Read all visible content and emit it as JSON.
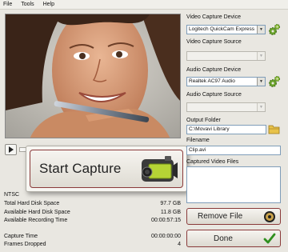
{
  "menu": [
    "File",
    "Tools",
    "Help"
  ],
  "preview": {
    "play_icon": "play-icon"
  },
  "start_capture": {
    "label": "Start Capture",
    "icon": "camcorder-icon"
  },
  "info": {
    "standard": "NTSC",
    "total_disk_label": "Total Hard Disk Space",
    "total_disk_value": "97.7 GB",
    "available_disk_label": "Available Hard Disk Space",
    "available_disk_value": "11.8 GB",
    "available_time_label": "Available Recording Time",
    "available_time_value": "00:00:57:15",
    "capture_time_label": "Capture Time",
    "capture_time_value": "00:00:00:00",
    "frames_dropped_label": "Frames Dropped",
    "frames_dropped_value": "4"
  },
  "right": {
    "video_device_label": "Video Capture Device",
    "video_device_value": "Logitech QuickCam Express",
    "video_source_label": "Video Capture Source",
    "video_source_value": "",
    "audio_device_label": "Audio Capture Device",
    "audio_device_value": "Realtek AC97 Audio",
    "audio_source_label": "Audio Capture Source",
    "audio_source_value": "",
    "output_folder_label": "Output Folder",
    "output_folder_value": "C:\\Movavi Library",
    "filename_label": "Filename",
    "filename_value": "Clip.avi",
    "captured_files_label": "Captured Video Files",
    "remove_label": "Remove File",
    "done_label": "Done"
  },
  "colors": {
    "accent_border": "#8a3a3a",
    "gear_green": "#5f9a2a",
    "done_check": "#2f8f1f"
  }
}
